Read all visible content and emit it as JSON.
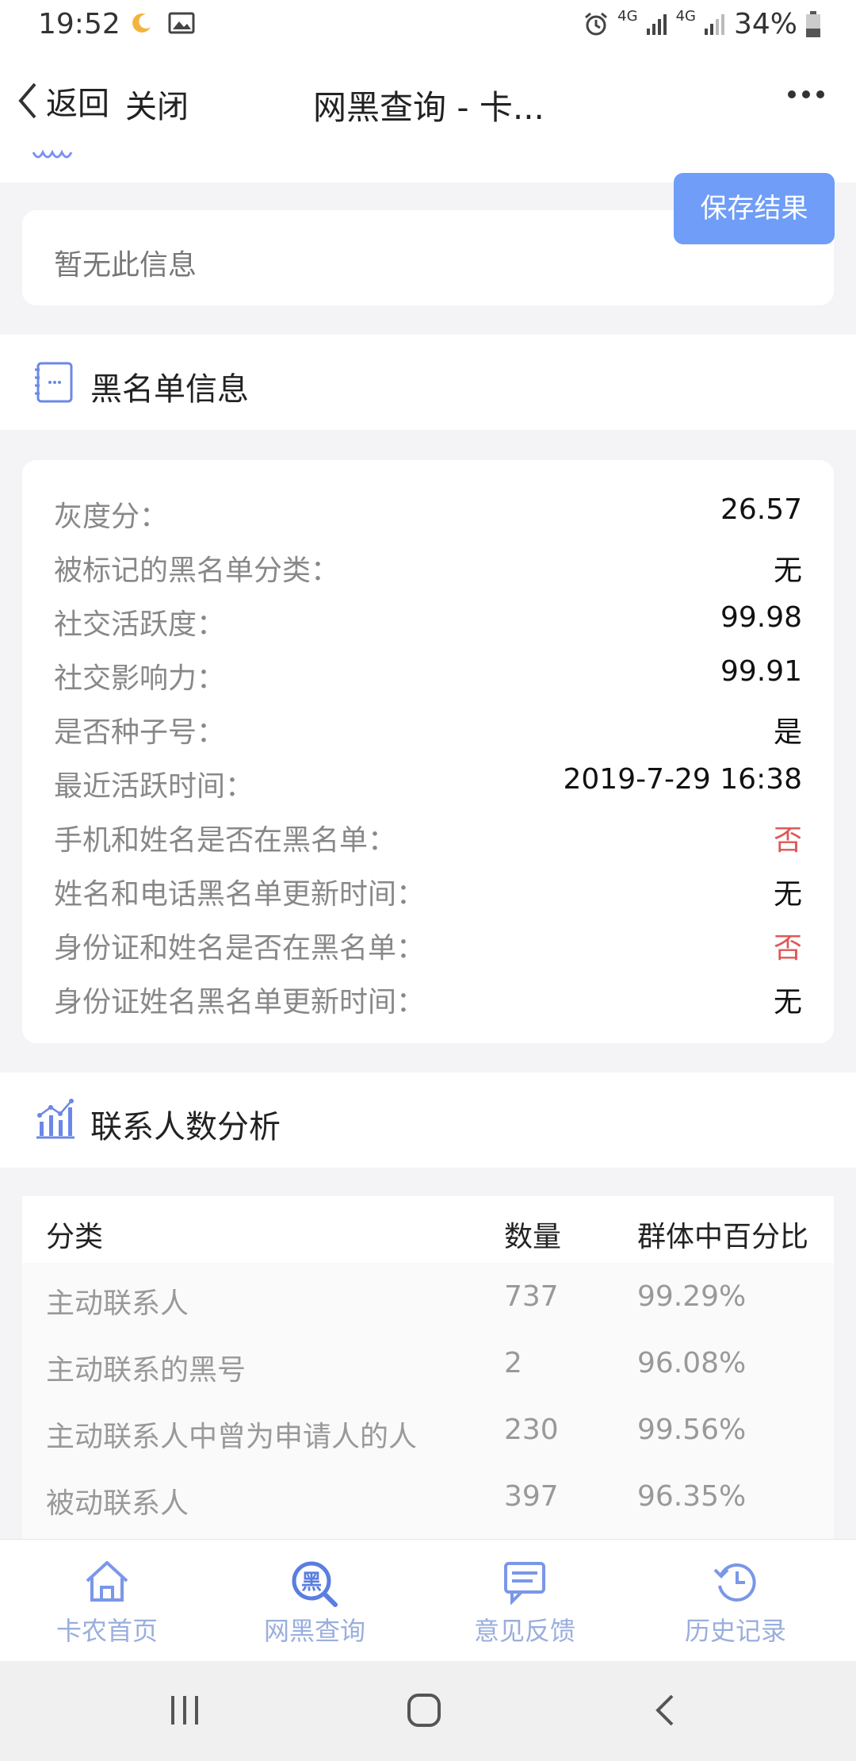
{
  "status_bar": {
    "time": "19:52",
    "battery": "34%",
    "net1": "4G",
    "net2": "4G"
  },
  "nav": {
    "back_label": "返回",
    "close_label": "关闭",
    "title": "网黑查询 - 卡..."
  },
  "no_info": {
    "text": "暂无此信息"
  },
  "save_button": "保存结果",
  "blacklist_section": {
    "title": "黑名单信息",
    "rows": [
      {
        "label": "灰度分：",
        "value": "26.57",
        "highlight": false
      },
      {
        "label": "被标记的黑名单分类：",
        "value": "无",
        "highlight": false
      },
      {
        "label": "社交活跃度：",
        "value": "99.98",
        "highlight": false
      },
      {
        "label": "社交影响力：",
        "value": "99.91",
        "highlight": false
      },
      {
        "label": "是否种子号：",
        "value": "是",
        "highlight": false
      },
      {
        "label": "最近活跃时间：",
        "value": "2019-7-29 16:38",
        "highlight": false
      },
      {
        "label": "手机和姓名是否在黑名单：",
        "value": "否",
        "highlight": true
      },
      {
        "label": "姓名和电话黑名单更新时间：",
        "value": "无",
        "highlight": false
      },
      {
        "label": "身份证和姓名是否在黑名单：",
        "value": "否",
        "highlight": true
      },
      {
        "label": "身份证姓名黑名单更新时间：",
        "value": "无",
        "highlight": false
      }
    ]
  },
  "contacts_section": {
    "title": "联系人数分析",
    "columns": [
      "分类",
      "数量",
      "群体中百分比"
    ],
    "rows": [
      [
        "主动联系人",
        "737",
        "99.29%"
      ],
      [
        "主动联系的黑号",
        "2",
        "96.08%"
      ],
      [
        "主动联系人中曾为申请人的人",
        "230",
        "99.56%"
      ],
      [
        "被动联系人",
        "397",
        "96.35%"
      ]
    ]
  },
  "tabs": [
    {
      "label": "卡农首页",
      "icon": "home-icon"
    },
    {
      "label": "网黑查询",
      "icon": "blacklist-search-icon"
    },
    {
      "label": "意见反馈",
      "icon": "feedback-icon"
    },
    {
      "label": "历史记录",
      "icon": "history-icon"
    }
  ],
  "colors": {
    "accent": "#6f9df7",
    "tab_color": "#9aaedd",
    "red": "#e05757"
  }
}
